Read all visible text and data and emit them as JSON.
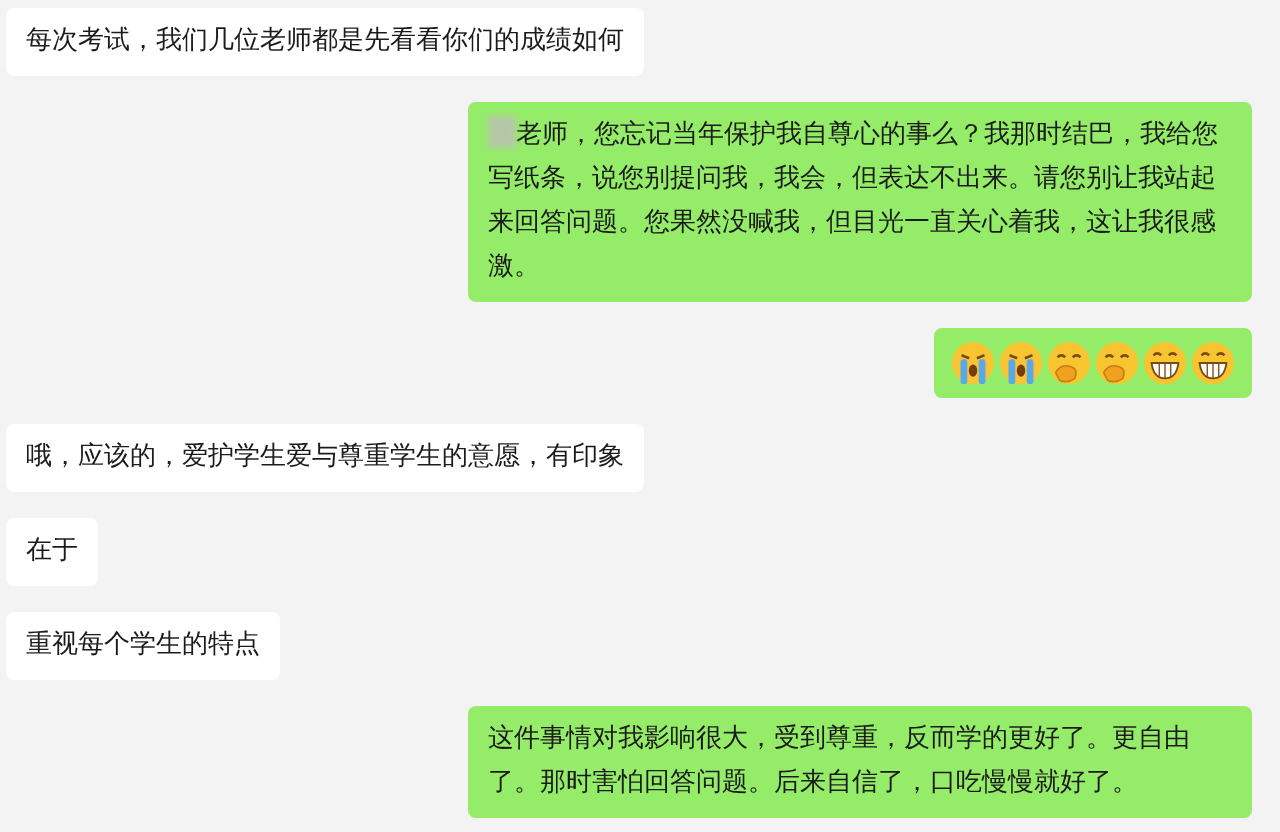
{
  "messages": [
    {
      "outgoing": false,
      "text": "每次考试，我们几位老师都是先看看你们的成绩如何"
    },
    {
      "outgoing": true,
      "redacted": true,
      "text": "老师，您忘记当年保护我自尊心的事么？我那时结巴，我给您写纸条，说您别提问我，我会，但表达不出来。请您别让我站起来回答问题。您果然没喊我，但目光一直关心着我，这让我很感激。"
    },
    {
      "outgoing": true,
      "emojis": [
        {
          "kind": "cry"
        },
        {
          "kind": "cry"
        },
        {
          "kind": "chuckle"
        },
        {
          "kind": "chuckle"
        },
        {
          "kind": "grin"
        },
        {
          "kind": "grin"
        }
      ]
    },
    {
      "outgoing": false,
      "text": "哦，应该的，爱护学生爱与尊重学生的意愿，有印象"
    },
    {
      "outgoing": false,
      "text": "在于"
    },
    {
      "outgoing": false,
      "text": "重视每个学生的特点"
    },
    {
      "outgoing": true,
      "text": "这件事情对我影响很大，受到尊重，反而学的更好了。更自由了。那时害怕回答问题。后来自信了，口吃慢慢就好了。"
    }
  ]
}
